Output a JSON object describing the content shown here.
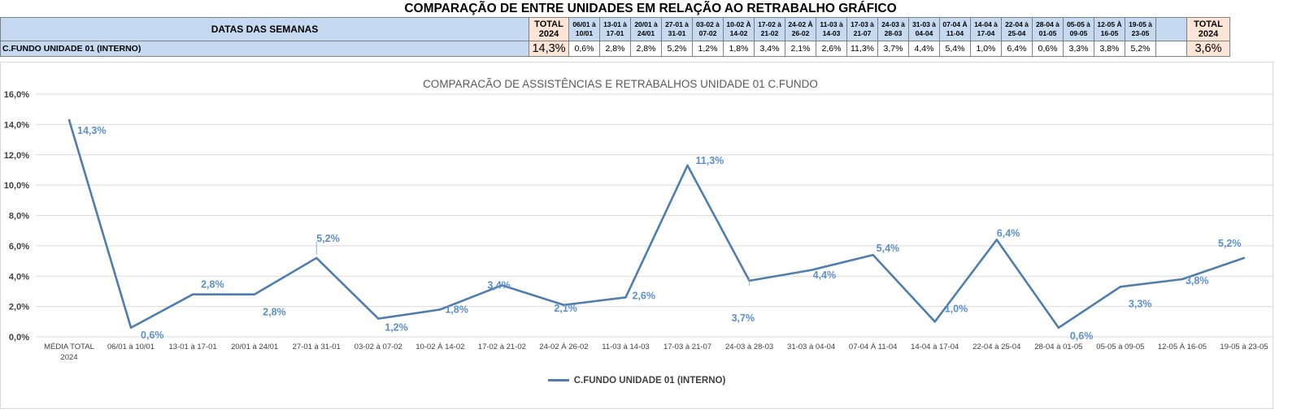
{
  "page_title": "COMPARAÇÃO DE ENTRE UNIDADES EM RELAÇÃO AO RETRABALHO GRÁFICO",
  "table": {
    "weeks_label": "DATAS DAS SEMANAS",
    "total_left_lines": [
      "TOTAL",
      "2024"
    ],
    "total_right_lines": [
      "TOTAL",
      "2024"
    ],
    "columns": [
      [
        "06/01 à",
        "10/01"
      ],
      [
        "13-01 à",
        "17-01"
      ],
      [
        "20/01 à",
        "24/01"
      ],
      [
        "27-01 à",
        "31-01"
      ],
      [
        "03-02 à",
        "07-02"
      ],
      [
        "10-02 À",
        "14-02"
      ],
      [
        "17-02 à",
        "21-02"
      ],
      [
        "24-02 À",
        "26-02"
      ],
      [
        "11-03 à",
        "14-03"
      ],
      [
        "17-03 à",
        "21-07"
      ],
      [
        "24-03 à",
        "28-03"
      ],
      [
        "31-03 à",
        "04-04"
      ],
      [
        "07-04 À",
        "11-04"
      ],
      [
        "14-04 à",
        "17-04"
      ],
      [
        "22-04 à",
        "25-04"
      ],
      [
        "28-04 à",
        "01-05"
      ],
      [
        "05-05 à",
        "09-05"
      ],
      [
        "12-05 À",
        "16-05"
      ],
      [
        "19-05 à",
        "23-05"
      ],
      [
        "",
        ""
      ]
    ],
    "row_label": "C.FUNDO UNIDADE 01 (INTERNO)",
    "row_total_left": "14,3%",
    "row_values": [
      "0,6%",
      "2,8%",
      "2,8%",
      "5,2%",
      "1,2%",
      "1,8%",
      "3,4%",
      "2,1%",
      "2,6%",
      "11,3%",
      "3,7%",
      "4,4%",
      "5,4%",
      "1,0%",
      "6,4%",
      "0,6%",
      "3,3%",
      "3,8%",
      "5,2%",
      ""
    ],
    "row_total_right": "3,6%"
  },
  "chart_data": {
    "type": "line",
    "title": "COMPARACÃO DE ASSISTÊNCIAS E RETRABALHOS UNIDADE 01 C.FUNDO",
    "x": [
      [
        "MÉDIA TOTAL",
        "2024"
      ],
      [
        "06/01 à 10/01"
      ],
      [
        "13-01 à 17-01"
      ],
      [
        "20/01 à 24/01"
      ],
      [
        "27-01 à 31-01"
      ],
      [
        "03-02 à 07-02"
      ],
      [
        "10-02 À 14-02"
      ],
      [
        "17-02 à 21-02"
      ],
      [
        "24-02 À 26-02"
      ],
      [
        "11-03 à 14-03"
      ],
      [
        "17-03 à 21-07"
      ],
      [
        "24-03 à 28-03"
      ],
      [
        "31-03 à 04-04"
      ],
      [
        "07-04 À 11-04"
      ],
      [
        "14-04 à 17-04"
      ],
      [
        "22-04 à 25-04"
      ],
      [
        "28-04 à 01-05"
      ],
      [
        "05-05 à 09-05"
      ],
      [
        "12-05 À 16-05"
      ],
      [
        "19-05 à 23-05"
      ]
    ],
    "series": [
      {
        "name": "C.FUNDO UNIDADE 01 (INTERNO)",
        "values": [
          14.3,
          0.6,
          2.8,
          2.8,
          5.2,
          1.2,
          1.8,
          3.4,
          2.1,
          2.6,
          11.3,
          3.7,
          4.4,
          5.4,
          1.0,
          6.4,
          0.6,
          3.3,
          3.8,
          5.2
        ],
        "labels": [
          "14,3%",
          "0,6%",
          "2,8%",
          "2,8%",
          "5,2%",
          "1,2%",
          "1,8%",
          "3,4%",
          "2,1%",
          "2,6%",
          "11,3%",
          "3,7%",
          "4,4%",
          "5,4%",
          "1,0%",
          "6,4%",
          "0,6%",
          "3,3%",
          "3,8%",
          "5,2%"
        ],
        "color": "#4f7dae"
      }
    ],
    "y_ticks": [
      "0,0%",
      "2,0%",
      "4,0%",
      "6,0%",
      "8,0%",
      "10,0%",
      "12,0%",
      "14,0%",
      "16,0%"
    ],
    "ylim": [
      0,
      16
    ],
    "grid": true,
    "legend": "bottom",
    "label_color": "#5b8fcb",
    "grid_color": "#d9d9d9"
  },
  "colors": {
    "header_blue": "#c5d9f1",
    "header_peach": "#fce4d6",
    "line": "#4f7dae",
    "label": "#5b8fcb"
  }
}
